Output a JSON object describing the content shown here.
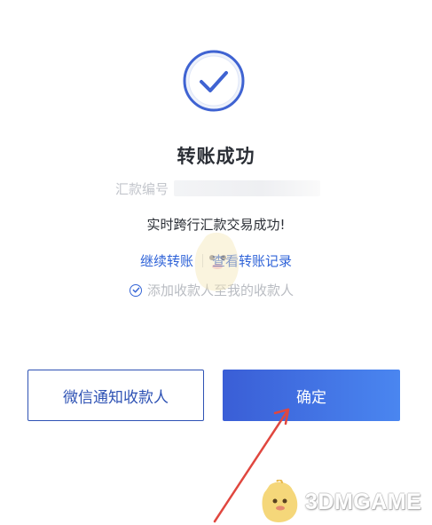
{
  "result": {
    "title": "转账成功",
    "serial_label": "汇款编号",
    "message": "实时跨行汇款交易成功!"
  },
  "links": {
    "continue_transfer": "继续转账",
    "view_records": "查看转账记录"
  },
  "payee_option": {
    "label": "添加收款人至我的收款人",
    "checked": true
  },
  "buttons": {
    "notify_wechat": "微信通知收款人",
    "confirm": "确定"
  },
  "watermark": {
    "text": "3DMGAME"
  },
  "colors": {
    "primary": "#3a5ed6",
    "link": "#2f63d8",
    "annotation_arrow": "#e0473f"
  }
}
